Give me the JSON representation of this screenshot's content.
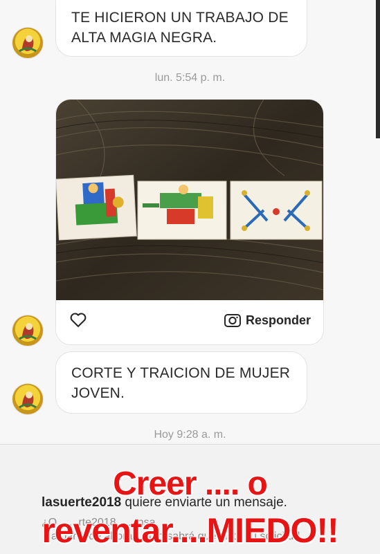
{
  "messages": [
    {
      "text_lines": [
        "TE HICIERON UN TRABAJO DE",
        "ALTA MAGIA NEGRA."
      ]
    },
    {
      "timestamp": "lun. 5:54 p. m."
    },
    {
      "photo_actions": {
        "reply_label": "Responder",
        "like_icon": "heart-icon",
        "camera_icon": "camera-icon"
      }
    },
    {
      "text_lines": [
        "CORTE Y TRAICION DE MUJER",
        "JOVEN."
      ]
    },
    {
      "timestamp": "Hoy 9:28 a. m."
    }
  ],
  "request": {
    "username": "lasuerte2018",
    "message": " quiere enviarte un mensaje.",
    "sub_line1": "¿Q... ...rte2018... ...nsa",
    "sub_line2": "a partir de ahora? Solo sabrá que viste su solicitud"
  },
  "overlay": {
    "line1": "Creer .... o",
    "line2": "reventar....MIEDO!!",
    "color": "#e61414"
  },
  "colors": {
    "bubble_border": "#e3e3e3",
    "timestamp": "#9a9a9a",
    "avatar": "#f3d23a"
  }
}
